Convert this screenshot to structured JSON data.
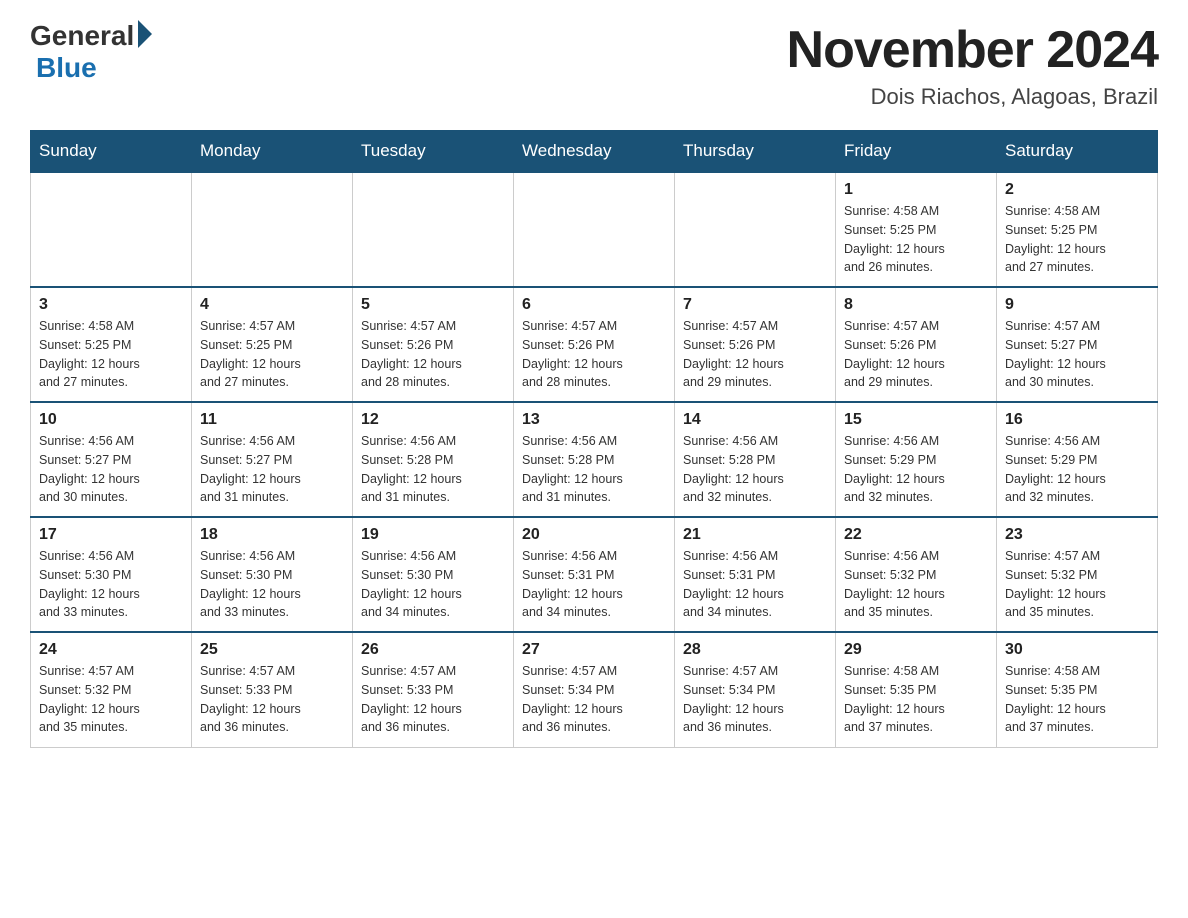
{
  "header": {
    "logo_general": "General",
    "logo_blue": "Blue",
    "month_title": "November 2024",
    "location": "Dois Riachos, Alagoas, Brazil"
  },
  "weekdays": [
    "Sunday",
    "Monday",
    "Tuesday",
    "Wednesday",
    "Thursday",
    "Friday",
    "Saturday"
  ],
  "weeks": [
    [
      {
        "day": "",
        "info": ""
      },
      {
        "day": "",
        "info": ""
      },
      {
        "day": "",
        "info": ""
      },
      {
        "day": "",
        "info": ""
      },
      {
        "day": "",
        "info": ""
      },
      {
        "day": "1",
        "info": "Sunrise: 4:58 AM\nSunset: 5:25 PM\nDaylight: 12 hours\nand 26 minutes."
      },
      {
        "day": "2",
        "info": "Sunrise: 4:58 AM\nSunset: 5:25 PM\nDaylight: 12 hours\nand 27 minutes."
      }
    ],
    [
      {
        "day": "3",
        "info": "Sunrise: 4:58 AM\nSunset: 5:25 PM\nDaylight: 12 hours\nand 27 minutes."
      },
      {
        "day": "4",
        "info": "Sunrise: 4:57 AM\nSunset: 5:25 PM\nDaylight: 12 hours\nand 27 minutes."
      },
      {
        "day": "5",
        "info": "Sunrise: 4:57 AM\nSunset: 5:26 PM\nDaylight: 12 hours\nand 28 minutes."
      },
      {
        "day": "6",
        "info": "Sunrise: 4:57 AM\nSunset: 5:26 PM\nDaylight: 12 hours\nand 28 minutes."
      },
      {
        "day": "7",
        "info": "Sunrise: 4:57 AM\nSunset: 5:26 PM\nDaylight: 12 hours\nand 29 minutes."
      },
      {
        "day": "8",
        "info": "Sunrise: 4:57 AM\nSunset: 5:26 PM\nDaylight: 12 hours\nand 29 minutes."
      },
      {
        "day": "9",
        "info": "Sunrise: 4:57 AM\nSunset: 5:27 PM\nDaylight: 12 hours\nand 30 minutes."
      }
    ],
    [
      {
        "day": "10",
        "info": "Sunrise: 4:56 AM\nSunset: 5:27 PM\nDaylight: 12 hours\nand 30 minutes."
      },
      {
        "day": "11",
        "info": "Sunrise: 4:56 AM\nSunset: 5:27 PM\nDaylight: 12 hours\nand 31 minutes."
      },
      {
        "day": "12",
        "info": "Sunrise: 4:56 AM\nSunset: 5:28 PM\nDaylight: 12 hours\nand 31 minutes."
      },
      {
        "day": "13",
        "info": "Sunrise: 4:56 AM\nSunset: 5:28 PM\nDaylight: 12 hours\nand 31 minutes."
      },
      {
        "day": "14",
        "info": "Sunrise: 4:56 AM\nSunset: 5:28 PM\nDaylight: 12 hours\nand 32 minutes."
      },
      {
        "day": "15",
        "info": "Sunrise: 4:56 AM\nSunset: 5:29 PM\nDaylight: 12 hours\nand 32 minutes."
      },
      {
        "day": "16",
        "info": "Sunrise: 4:56 AM\nSunset: 5:29 PM\nDaylight: 12 hours\nand 32 minutes."
      }
    ],
    [
      {
        "day": "17",
        "info": "Sunrise: 4:56 AM\nSunset: 5:30 PM\nDaylight: 12 hours\nand 33 minutes."
      },
      {
        "day": "18",
        "info": "Sunrise: 4:56 AM\nSunset: 5:30 PM\nDaylight: 12 hours\nand 33 minutes."
      },
      {
        "day": "19",
        "info": "Sunrise: 4:56 AM\nSunset: 5:30 PM\nDaylight: 12 hours\nand 34 minutes."
      },
      {
        "day": "20",
        "info": "Sunrise: 4:56 AM\nSunset: 5:31 PM\nDaylight: 12 hours\nand 34 minutes."
      },
      {
        "day": "21",
        "info": "Sunrise: 4:56 AM\nSunset: 5:31 PM\nDaylight: 12 hours\nand 34 minutes."
      },
      {
        "day": "22",
        "info": "Sunrise: 4:56 AM\nSunset: 5:32 PM\nDaylight: 12 hours\nand 35 minutes."
      },
      {
        "day": "23",
        "info": "Sunrise: 4:57 AM\nSunset: 5:32 PM\nDaylight: 12 hours\nand 35 minutes."
      }
    ],
    [
      {
        "day": "24",
        "info": "Sunrise: 4:57 AM\nSunset: 5:32 PM\nDaylight: 12 hours\nand 35 minutes."
      },
      {
        "day": "25",
        "info": "Sunrise: 4:57 AM\nSunset: 5:33 PM\nDaylight: 12 hours\nand 36 minutes."
      },
      {
        "day": "26",
        "info": "Sunrise: 4:57 AM\nSunset: 5:33 PM\nDaylight: 12 hours\nand 36 minutes."
      },
      {
        "day": "27",
        "info": "Sunrise: 4:57 AM\nSunset: 5:34 PM\nDaylight: 12 hours\nand 36 minutes."
      },
      {
        "day": "28",
        "info": "Sunrise: 4:57 AM\nSunset: 5:34 PM\nDaylight: 12 hours\nand 36 minutes."
      },
      {
        "day": "29",
        "info": "Sunrise: 4:58 AM\nSunset: 5:35 PM\nDaylight: 12 hours\nand 37 minutes."
      },
      {
        "day": "30",
        "info": "Sunrise: 4:58 AM\nSunset: 5:35 PM\nDaylight: 12 hours\nand 37 minutes."
      }
    ]
  ]
}
